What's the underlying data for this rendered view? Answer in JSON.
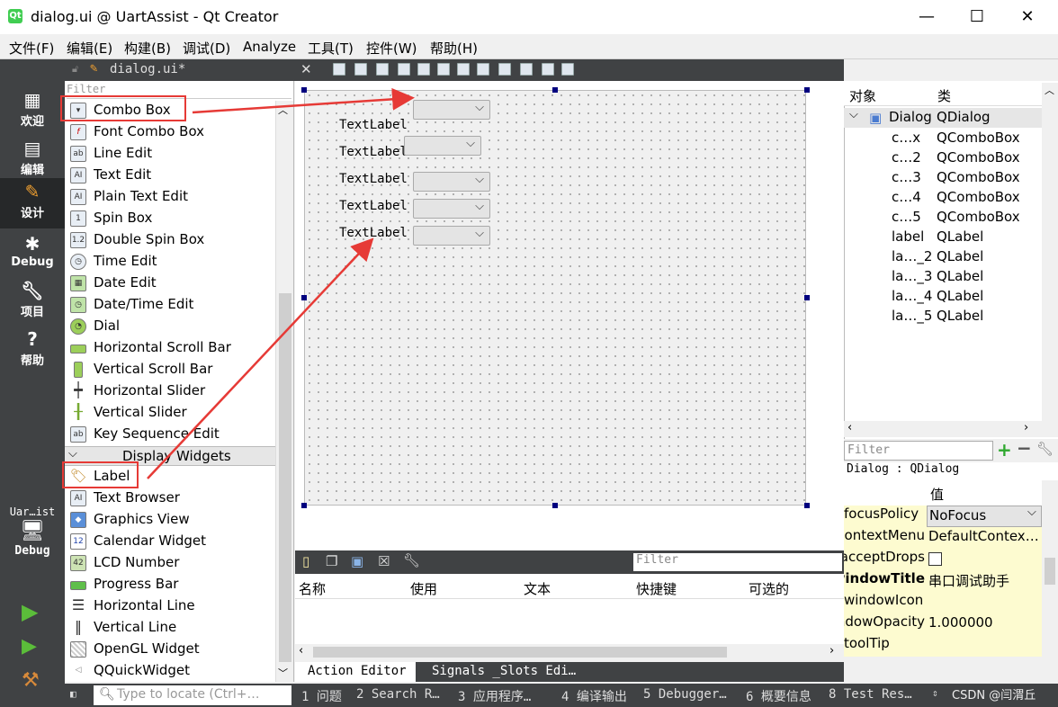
{
  "window": {
    "title": "dialog.ui @ UartAssist - Qt Creator",
    "icon": "qt-icon",
    "minimize": "—",
    "maximize": "☐",
    "close": "✕"
  },
  "menu": [
    "文件(F)",
    "编辑(E)",
    "构建(B)",
    "调试(D)",
    "Analyze",
    "工具(T)",
    "控件(W)",
    "帮助(H)"
  ],
  "modes": [
    {
      "label": "欢迎",
      "icon": "grid-icon"
    },
    {
      "label": "编辑",
      "icon": "doc-icon"
    },
    {
      "label": "设计",
      "icon": "pen-icon"
    },
    {
      "label": "Debug",
      "icon": "bug-icon"
    },
    {
      "label": "项目",
      "icon": "wrench-icon"
    },
    {
      "label": "帮助",
      "icon": "help-icon"
    }
  ],
  "target": {
    "project": "Uar…ist",
    "mode": "Debug"
  },
  "document": {
    "tab": "dialog.ui*",
    "close": "✕"
  },
  "widget_box": {
    "filter_placeholder": "Filter",
    "items": [
      "Combo Box",
      "Font Combo Box",
      "Line Edit",
      "Text Edit",
      "Plain Text Edit",
      "Spin Box",
      "Double Spin Box",
      "Time Edit",
      "Date Edit",
      "Date/Time Edit",
      "Dial",
      "Horizontal Scroll Bar",
      "Vertical Scroll Bar",
      "Horizontal Slider",
      "Vertical Slider",
      "Key Sequence Edit"
    ],
    "category": "Display Widgets",
    "display_items": [
      "Label",
      "Text Browser",
      "Graphics View",
      "Calendar Widget",
      "LCD Number",
      "Progress Bar",
      "Horizontal Line",
      "Vertical Line",
      "OpenGL Widget",
      "QQuickWidget"
    ]
  },
  "form": {
    "labels": [
      "TextLabel",
      "TextLabel",
      "TextLabel",
      "TextLabel",
      "TextLabel"
    ]
  },
  "action_editor": {
    "filter_placeholder": "Filter",
    "columns": [
      "名称",
      "使用",
      "文本",
      "快捷键",
      "可选的"
    ],
    "tabs": [
      "Action Editor",
      "Signals _Slots Edi…"
    ]
  },
  "object_inspector": {
    "columns": [
      "对象",
      "类"
    ],
    "root": {
      "name": "Dialog",
      "class": "QDialog"
    },
    "children": [
      {
        "name": "c…x",
        "class": "QComboBox"
      },
      {
        "name": "c…2",
        "class": "QComboBox"
      },
      {
        "name": "c…3",
        "class": "QComboBox"
      },
      {
        "name": "c…4",
        "class": "QComboBox"
      },
      {
        "name": "c…5",
        "class": "QComboBox"
      },
      {
        "name": "label",
        "class": "QLabel"
      },
      {
        "name": "la…_2",
        "class": "QLabel"
      },
      {
        "name": "la…_3",
        "class": "QLabel"
      },
      {
        "name": "la…_4",
        "class": "QLabel"
      },
      {
        "name": "la…_5",
        "class": "QLabel"
      }
    ]
  },
  "property_editor": {
    "filter_placeholder": "Filter",
    "class_line": "Dialog : QDialog",
    "value_header": "值",
    "rows": [
      {
        "k": "focusPolicy",
        "v": "NoFocus"
      },
      {
        "k": "contextMenu…",
        "v": "DefaultContex…"
      },
      {
        "k": "acceptDrops",
        "v": ""
      },
      {
        "k": "windowTitle",
        "v": "串口调试助手"
      },
      {
        "k": "windowIcon",
        "v": ""
      },
      {
        "k": "windowOpacity",
        "v": "1.000000"
      },
      {
        "k": "toolTip",
        "v": ""
      }
    ]
  },
  "statusbar": {
    "locate_placeholder": "Type to locate (Ctrl+…",
    "items": [
      "1 问题",
      "2 Search R…",
      "3 应用程序…",
      "4 编译输出",
      "5 Debugger…",
      "6 概要信息",
      "8 Test Res…"
    ],
    "watermark": "CSDN @闫渭丘"
  },
  "colors": {
    "annotation": "#e63a36",
    "mode_bar": "#404244",
    "handle": "#00007f"
  }
}
